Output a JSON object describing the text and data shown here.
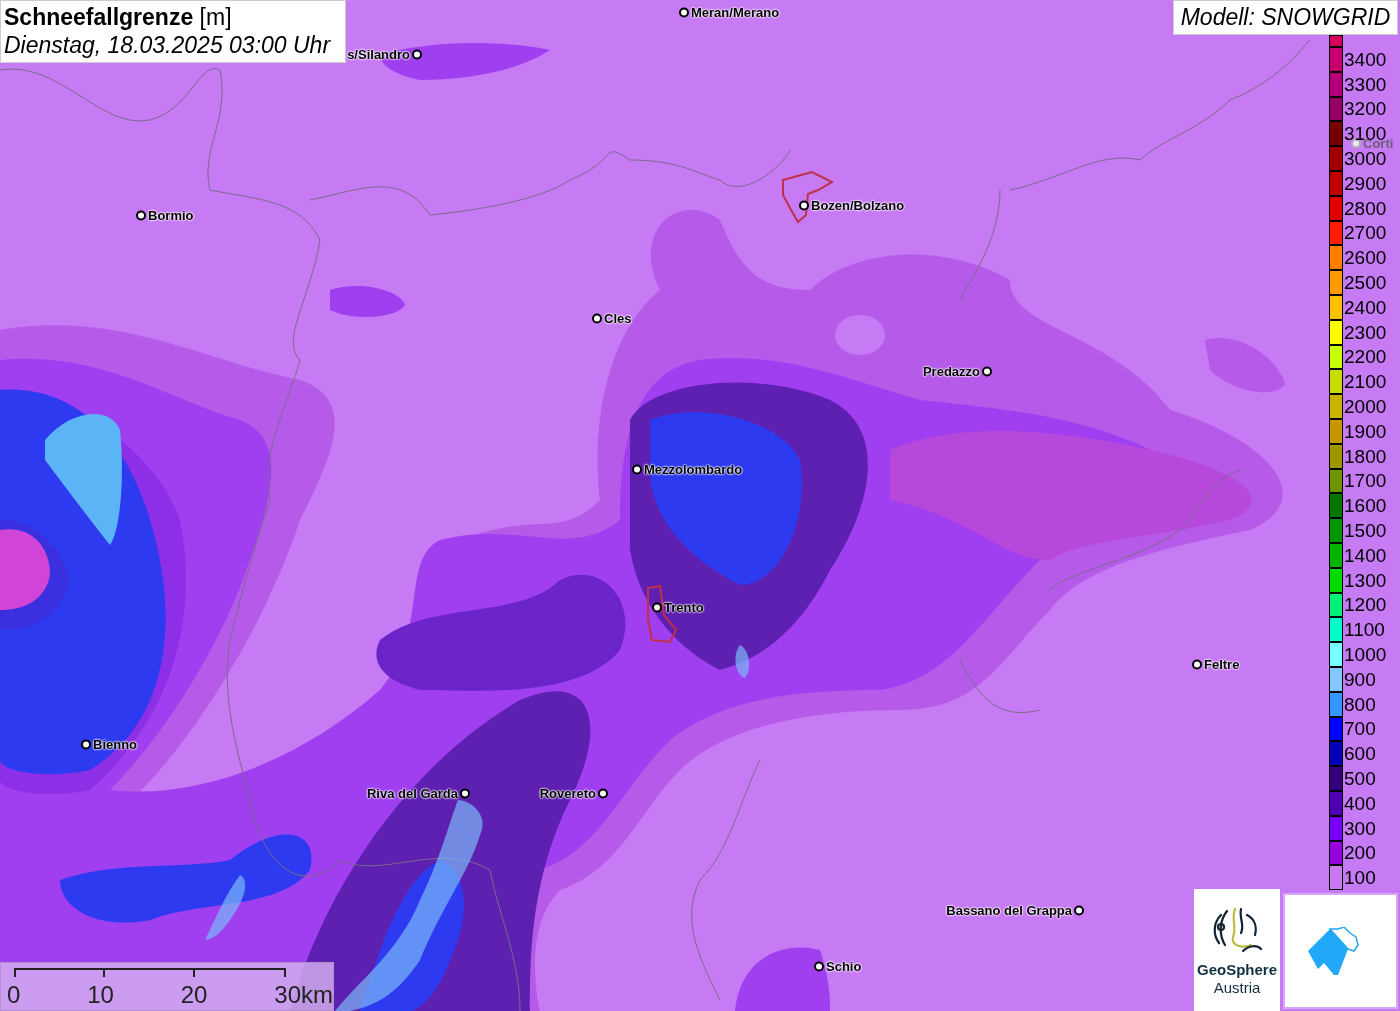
{
  "header": {
    "title": "**Schneefallgrenze** [m]",
    "subtitle": "Dienstag, 18.03.2025 03:00 Uhr"
  },
  "model": "Modell: SNOWGRID",
  "places": [
    {
      "name": "Meran/Merano",
      "faded": false
    },
    {
      "name": "s/Silandro",
      "faded": false
    },
    {
      "name": "Bormio",
      "faded": false
    },
    {
      "name": "Bozen/Bolzano",
      "faded": false
    },
    {
      "name": "Cles",
      "faded": false
    },
    {
      "name": "Predazzo",
      "faded": false
    },
    {
      "name": "Mezzolombardo",
      "faded": false
    },
    {
      "name": "Trento",
      "faded": false
    },
    {
      "name": "Feltre",
      "faded": false
    },
    {
      "name": "Bienno",
      "faded": false
    },
    {
      "name": "Riva del Garda",
      "faded": false
    },
    {
      "name": "Rovereto",
      "faded": false
    },
    {
      "name": "Bassano del Grappa",
      "faded": false
    },
    {
      "name": "Schio",
      "faded": false
    },
    {
      "name": "Corti",
      "faded": true
    }
  ],
  "legend": [
    {
      "color": "#d2005a"
    },
    {
      "label": "3400",
      "color": "#c8006e"
    },
    {
      "label": "3300",
      "color": "#b40078"
    },
    {
      "label": "3200",
      "color": "#960064"
    },
    {
      "label": "3100",
      "color": "#780000"
    },
    {
      "label": "3000",
      "color": "#a00000"
    },
    {
      "label": "2900",
      "color": "#c00000"
    },
    {
      "label": "2800",
      "color": "#e00000"
    },
    {
      "label": "2700",
      "color": "#ff1e00"
    },
    {
      "label": "2600",
      "color": "#ff8000"
    },
    {
      "label": "2500",
      "color": "#ff9a00"
    },
    {
      "label": "2400",
      "color": "#ffc000"
    },
    {
      "label": "2300",
      "color": "#ffff00"
    },
    {
      "label": "2200",
      "color": "#c8ff00"
    },
    {
      "label": "2100",
      "color": "#c8dc00"
    },
    {
      "label": "2000",
      "color": "#c8b400"
    },
    {
      "label": "1900",
      "color": "#c89600"
    },
    {
      "label": "1800",
      "color": "#a09600"
    },
    {
      "label": "1700",
      "color": "#6e9600"
    },
    {
      "label": "1600",
      "color": "#007800"
    },
    {
      "label": "1500",
      "color": "#009600"
    },
    {
      "label": "1400",
      "color": "#00b400"
    },
    {
      "label": "1300",
      "color": "#00dc00"
    },
    {
      "label": "1200",
      "color": "#00f078"
    },
    {
      "label": "1100",
      "color": "#00ffc8"
    },
    {
      "label": "1000",
      "color": "#78ffff"
    },
    {
      "label": "900",
      "color": "#82c8ff"
    },
    {
      "label": "800",
      "color": "#3296ff"
    },
    {
      "label": "700",
      "color": "#0000ff"
    },
    {
      "label": "600",
      "color": "#0000b4"
    },
    {
      "label": "500",
      "color": "#320078"
    },
    {
      "label": "400",
      "color": "#5000b4"
    },
    {
      "label": "300",
      "color": "#7800ff"
    },
    {
      "label": "200",
      "color": "#9600dc"
    },
    {
      "label": "100",
      "color": "#c878f0"
    }
  ],
  "scale_bar": {
    "ticks": [
      "0",
      "10",
      "20",
      "30km"
    ]
  },
  "logos": [
    {
      "name": "GeoSphere",
      "subtitle": "Austria"
    }
  ]
}
